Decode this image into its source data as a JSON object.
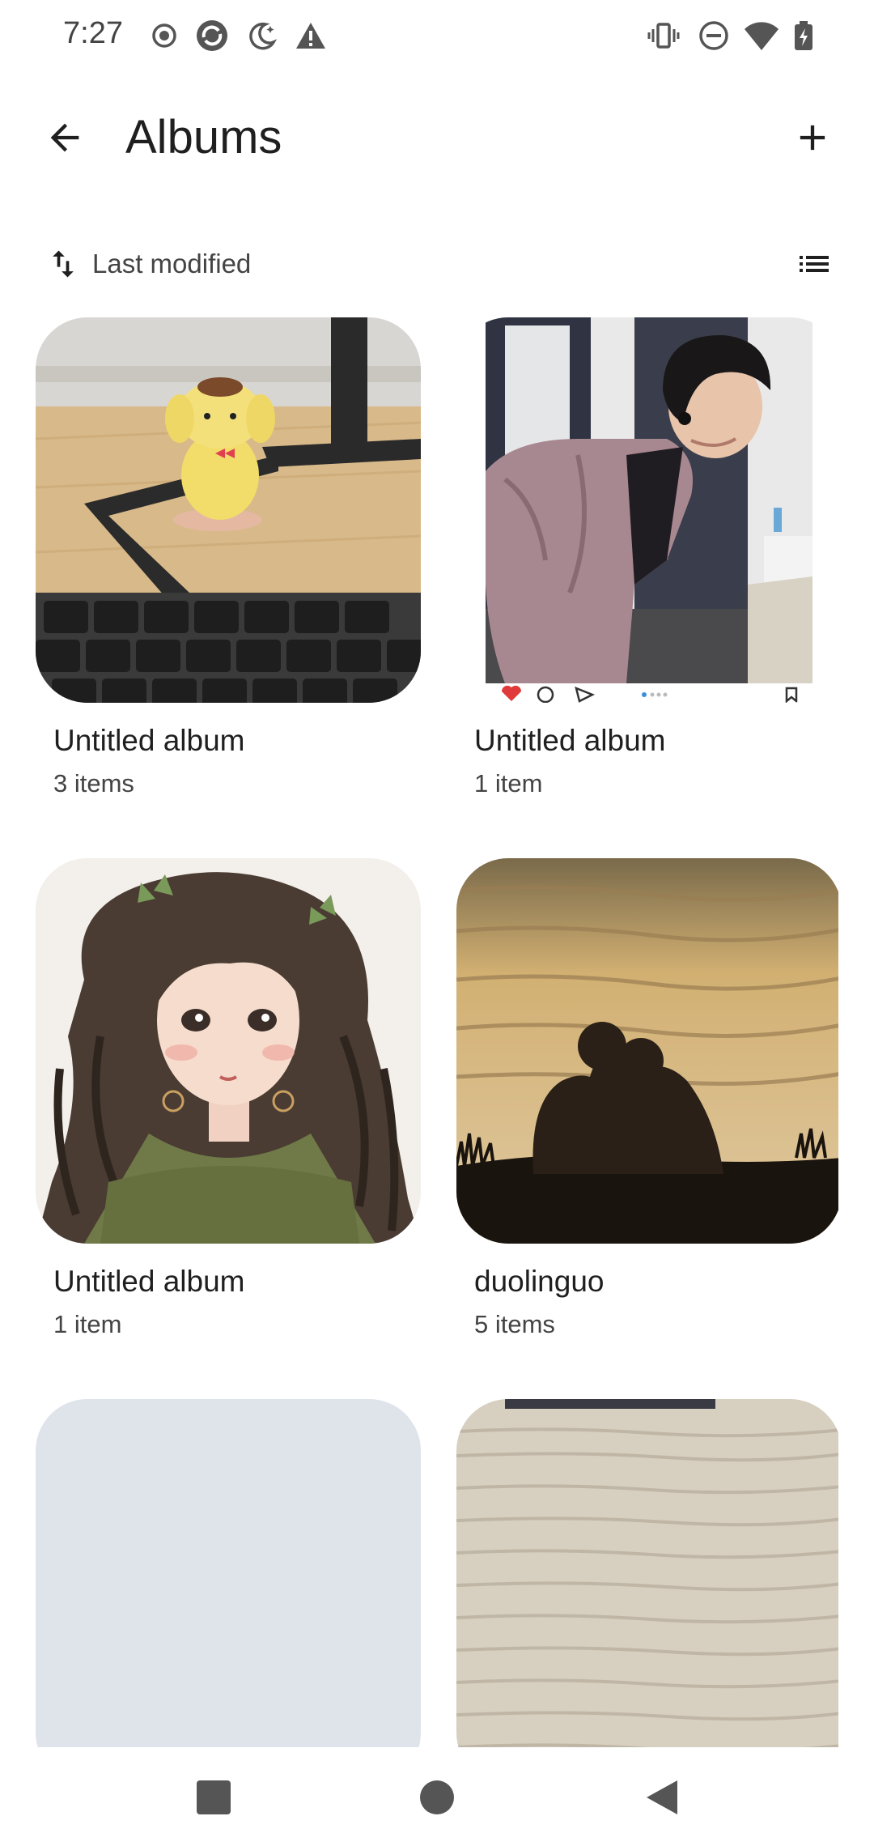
{
  "status_bar": {
    "time": "7:27",
    "left_icons": [
      "record-icon",
      "sync-icon",
      "night-mode-icon",
      "warning-icon"
    ],
    "right_icons": [
      "vibrate-icon",
      "do-not-disturb-icon",
      "wifi-icon",
      "battery-charging-icon"
    ]
  },
  "app_bar": {
    "title": "Albums",
    "back_icon": "arrow-back-icon",
    "add_icon": "add-icon"
  },
  "sort": {
    "label": "Last modified",
    "icon": "swap-vertical-icon",
    "view_icon": "list-view-icon"
  },
  "albums": [
    {
      "title": "Untitled album",
      "count": "3 items"
    },
    {
      "title": "Untitled album",
      "count": "1 item"
    },
    {
      "title": "Untitled album",
      "count": "1 item"
    },
    {
      "title": "duolinguo",
      "count": "5 items"
    },
    {
      "title": "",
      "count": ""
    },
    {
      "title": "",
      "count": ""
    }
  ],
  "nav_bar": {
    "icons": [
      "recents-square-icon",
      "home-circle-icon",
      "back-triangle-icon"
    ]
  },
  "colors": {
    "text_primary": "#1f1f1f",
    "text_secondary": "#444444",
    "placeholder_album": "#dfe3ea"
  }
}
